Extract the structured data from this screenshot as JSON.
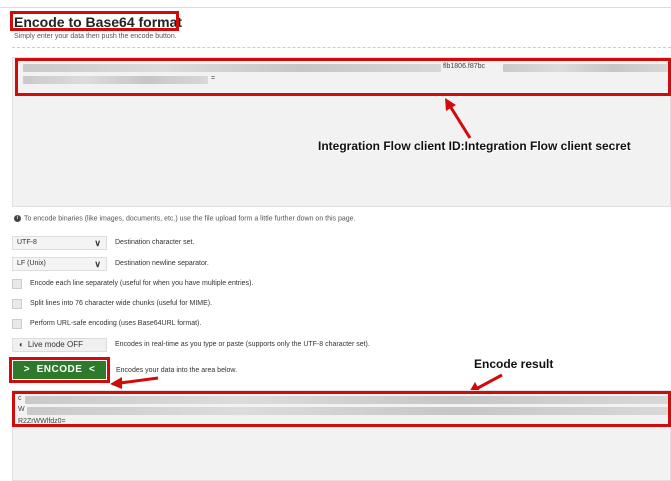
{
  "page": {
    "title": "Encode to Base64 format",
    "subtitle": "Simply enter your data then push the encode button."
  },
  "input": {
    "fragment_1": "flb1806.f87bc",
    "fragment_2": "="
  },
  "annotations": {
    "input_label": "Integration Flow client ID:Integration Flow client secret",
    "result_label": "Encode result"
  },
  "info_note": "To encode binaries (like images, documents, etc.) use the file upload form a little further down on this page.",
  "options": {
    "charset": {
      "value": "UTF-8",
      "label": "Destination character set."
    },
    "newline": {
      "value": "LF (Unix)",
      "label": "Destination newline separator."
    },
    "checkboxes": [
      {
        "label": "Encode each line separately (useful for when you have multiple entries).",
        "checked": false
      },
      {
        "label": "Split lines into 76 character wide chunks (useful for MIME).",
        "checked": false
      },
      {
        "label": "Perform URL-safe encoding (uses Base64URL format).",
        "checked": false
      }
    ],
    "live_mode": {
      "label": "Live mode OFF",
      "description": "Encodes in real-time as you type or paste (supports only the UTF-8 character set)."
    }
  },
  "encode": {
    "button_label": "ENCODE",
    "description": "Encodes your data into the area below."
  },
  "result": {
    "line_1": "c",
    "line_2": "W",
    "line_3": "R2ZrWWlfdz0="
  },
  "colors": {
    "annotation_red": "#d10a0a",
    "button_green": "#2d7a2d"
  }
}
